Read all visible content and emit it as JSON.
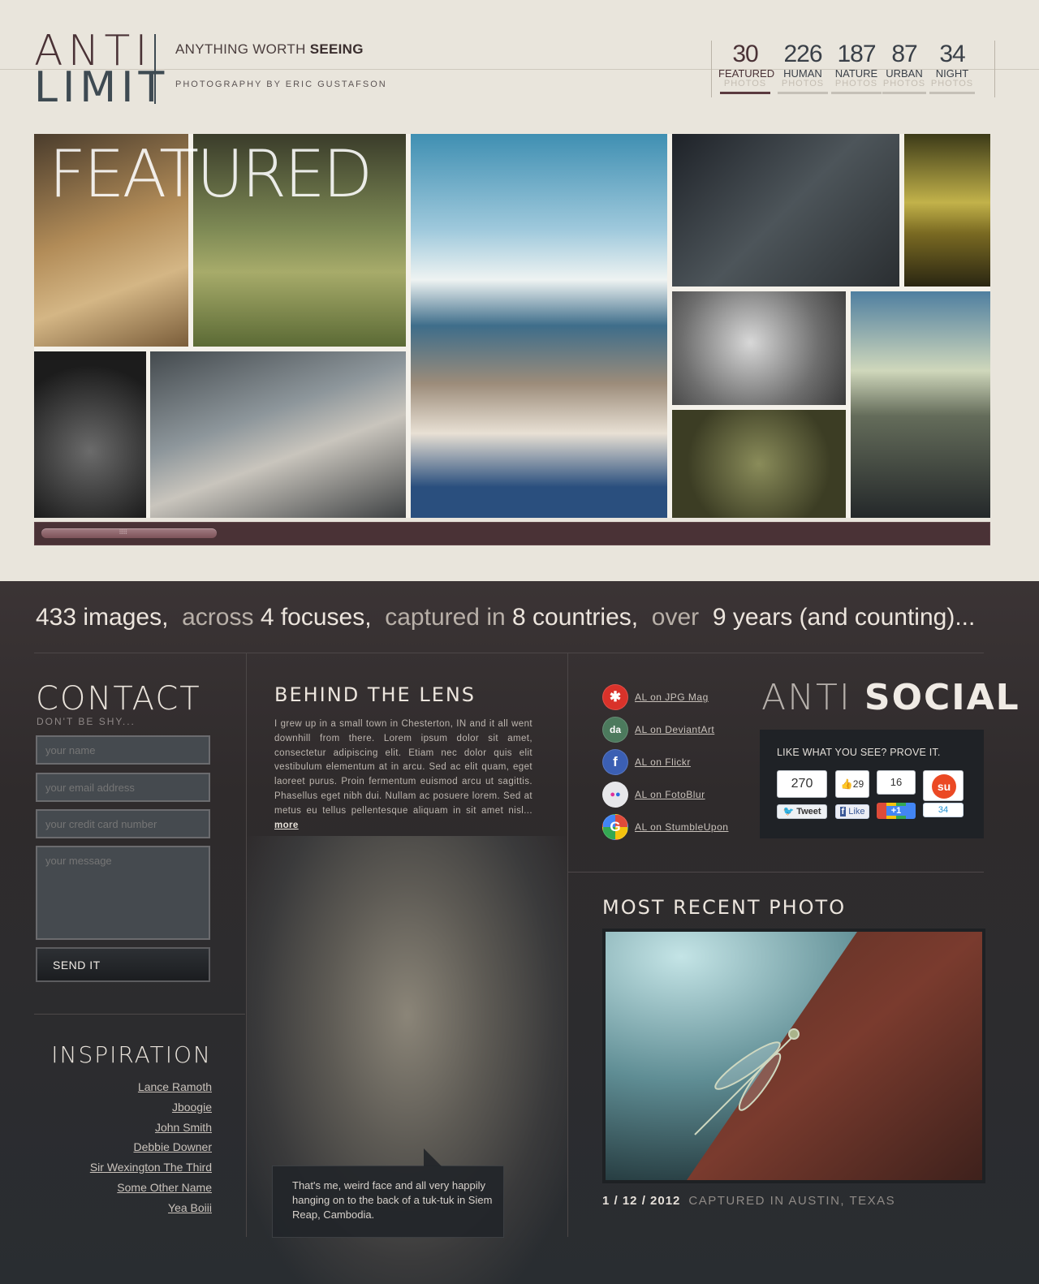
{
  "header": {
    "logo_top": "ANTI",
    "logo_bottom": "LIMIT",
    "tagline_prefix": "ANYTHING WORTH ",
    "tagline_bold": "SEEING",
    "byline": "PHOTOGRAPHY BY ERIC GUSTAFSON"
  },
  "stats": [
    {
      "num": "30",
      "label": "FEATURED",
      "sub": "PHOTOS",
      "active": true
    },
    {
      "num": "226",
      "label": "HUMAN",
      "sub": "PHOTOS",
      "active": false
    },
    {
      "num": "187",
      "label": "NATURE",
      "sub": "PHOTOS",
      "active": false
    },
    {
      "num": "87",
      "label": "URBAN",
      "sub": "PHOTOS",
      "active": false
    },
    {
      "num": "34",
      "label": "NIGHT",
      "sub": "PHOTOS",
      "active": false
    }
  ],
  "gallery": {
    "title": "FEATURED",
    "scroll_position": 0.0
  },
  "summary": {
    "images": "433 images,",
    "across": "across",
    "focuses": "4 focuses,",
    "captured": "captured in",
    "countries": "8 countries,",
    "over": "over",
    "years": "9 years (and counting)..."
  },
  "contact": {
    "title": "CONTACT",
    "subtitle": "DON'T BE SHY...",
    "name_placeholder": "your name",
    "email_placeholder": "your email address",
    "card_placeholder": "your credit card number",
    "message_placeholder": "your message",
    "send_label": "SEND IT"
  },
  "inspiration": {
    "title": "INSPIRATION",
    "links": [
      "Lance Ramoth",
      "Jboogie",
      "John Smith",
      "Debbie Downer",
      "Sir Wexington The Third",
      "Some Other Name",
      "Yea Boiii"
    ]
  },
  "behind": {
    "title": "BEHIND THE LENS",
    "text": "I grew up in a small town in Chesterton, IN and it all went downhill from there. Lorem ipsum dolor sit amet, consectetur adipiscing elit. Etiam nec dolor quis elit vestibulum elementum at in arcu. Sed ac elit quam, eget laoreet purus. Proin fermentum euismod arcu ut sagittis. Phasellus eget nibh dui. Nullam ac posuere lorem. Sed at metus eu tellus pellentesque aliquam in sit amet nisl...",
    "more": "more",
    "caption": "That's me, weird face and all very happily hanging on to the back of a tuk-tuk in Siem Reap, Cambodia."
  },
  "social": {
    "links": [
      {
        "label": "AL on JPG Mag",
        "icon": "jpgmag-icon",
        "color": "#d9322a",
        "glyph": "✱"
      },
      {
        "label": "AL on DeviantArt",
        "icon": "deviantart-icon",
        "color": "#4c7a5d",
        "glyph": "da"
      },
      {
        "label": "AL on Flickr",
        "icon": "flickr-icon",
        "color": "#3b5fb3",
        "glyph": "f"
      },
      {
        "label": "AL on FotoBlur",
        "icon": "fotoblur-icon",
        "color": "#e7e7ea",
        "glyph": "●●"
      },
      {
        "label": "AL on StumbleUpon",
        "icon": "stumbleupon-icon",
        "color": "#ffffff",
        "glyph": "G"
      }
    ],
    "title_thin": "ANTI",
    "title_bold": "SOCIAL",
    "prompt": "LIKE WHAT YOU SEE? PROVE IT.",
    "tweet_count": "270",
    "tweet_label": "Tweet",
    "like_count": "29",
    "like_label": "Like",
    "plusone_count": "16",
    "plusone_label": "+1",
    "stumble_count": "34"
  },
  "recent": {
    "title": "MOST RECENT PHOTO",
    "date": "1 / 12 / 2012",
    "location": "CAPTURED IN AUSTIN, TEXAS"
  },
  "colors": {
    "accent": "#4a3236",
    "page_light": "#e9e5dc",
    "page_dark": "#2a2b2e"
  }
}
